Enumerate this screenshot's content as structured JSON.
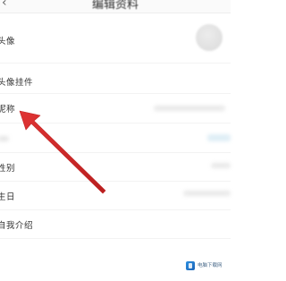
{
  "header": {
    "back_glyph": "‹",
    "title": "编辑资料"
  },
  "rows": {
    "avatar_label": "头像",
    "avatar_pendant_label": "头像挂件",
    "nickname_label": "昵称",
    "gender_label": "性别",
    "birthday_label": "生日",
    "bio_label": "自我介绍"
  },
  "watermark": {
    "text": "电脑下载网",
    "icon": "download-site-logo-icon",
    "accent": "#2d8fe0"
  },
  "annotation": {
    "arrow_color": "#d42a2a",
    "icon": "red-arrow-pointer-icon"
  }
}
